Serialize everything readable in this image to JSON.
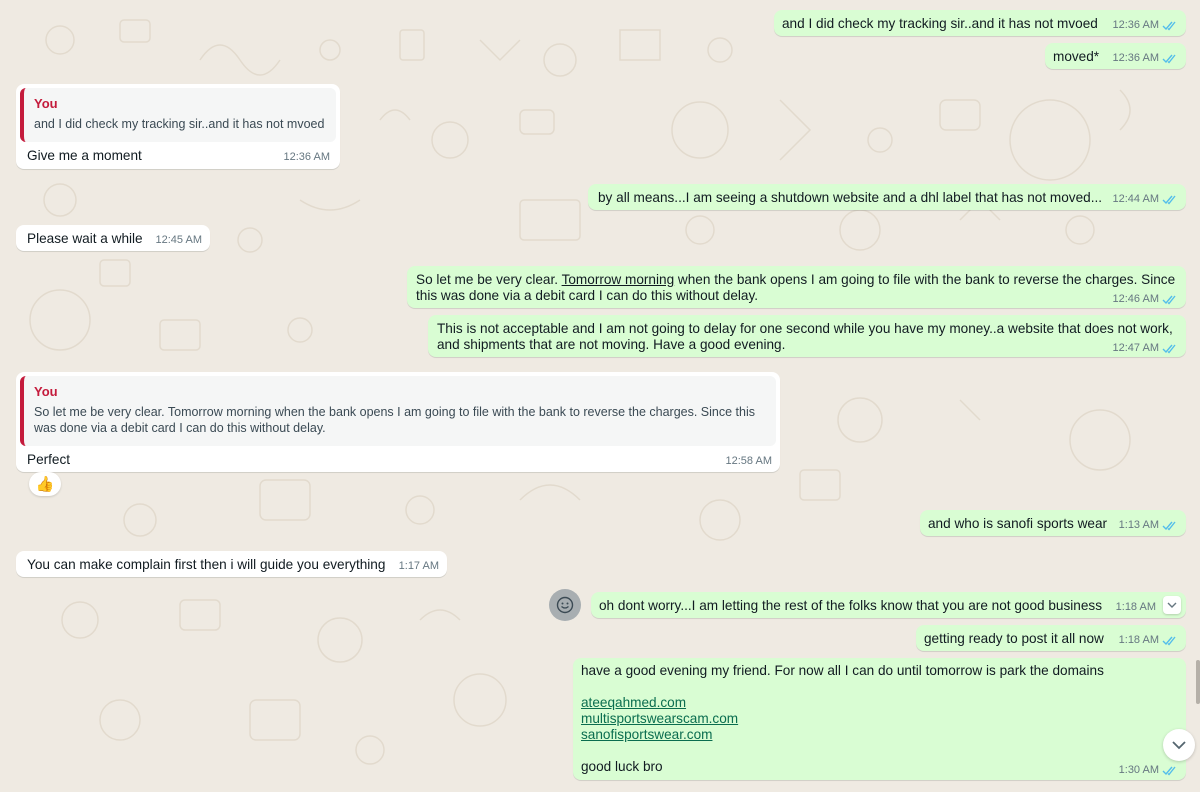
{
  "messages": [
    {
      "text": "and I did check my tracking sir..and it has not mvoed",
      "time": "12:36 AM"
    },
    {
      "text": "moved*",
      "time": "12:36 AM"
    },
    {
      "quote_author": "You",
      "quote_text": "and I did check my tracking sir..and it has not mvoed",
      "text": "Give me a moment",
      "time": "12:36 AM"
    },
    {
      "text": "by all means...I am seeing a shutdown website and a dhl label that has not moved...",
      "time": "12:44 AM"
    },
    {
      "text": "Please wait a while",
      "time": "12:45 AM"
    },
    {
      "text_before": "So let me be very clear. ",
      "text_underlined": "Tomorrow morning",
      "text_after_line1": " when the bank opens I am going to file with the bank to reverse the charges. Since",
      "text_line2": "this was done via a debit card I can do this without delay.",
      "time": "12:46 AM"
    },
    {
      "line1": "This is not acceptable and I am not going to delay for one second while you have my money..a website that does not work,",
      "line2": "and shipments that are not moving. Have a good evening.",
      "time": "12:47 AM"
    },
    {
      "quote_author": "You",
      "quote_line1": "So let me be very clear. Tomorrow morning when the bank opens I am going to file with the bank to reverse the charges. Since this",
      "quote_line2": "was done via a debit card I can do this without delay.",
      "text": "Perfect",
      "time": "12:58 AM",
      "reaction": "👍"
    },
    {
      "text": "and who is sanofi sports wear",
      "time": "1:13 AM"
    },
    {
      "text": "You can make complain first then i will guide you everything",
      "time": "1:17 AM"
    },
    {
      "text": "oh dont worry...I am letting the rest of the folks know that you are not good business",
      "time": "1:18 AM"
    },
    {
      "text": "getting ready to post it all now",
      "time": "1:18 AM"
    },
    {
      "line1": "have a good evening my friend. For now all I can do until tomorrow is park the domains",
      "links": [
        "ateeqahmed.com",
        "multisportswearscam.com",
        "sanofisportswear.com"
      ],
      "closing": "good luck bro",
      "time": "1:30 AM"
    }
  ],
  "colors": {
    "outgoing": "#d9fdd3",
    "incoming": "#ffffff",
    "read_ticks": "#53bdeb",
    "quote_bar": "#c41b3c",
    "wallpaper": "#efeae2"
  },
  "icons": {
    "emoji": "smiley-icon",
    "menu": "chevron-down-icon",
    "scroll": "chevron-down-icon",
    "status": "double-check-icon"
  }
}
